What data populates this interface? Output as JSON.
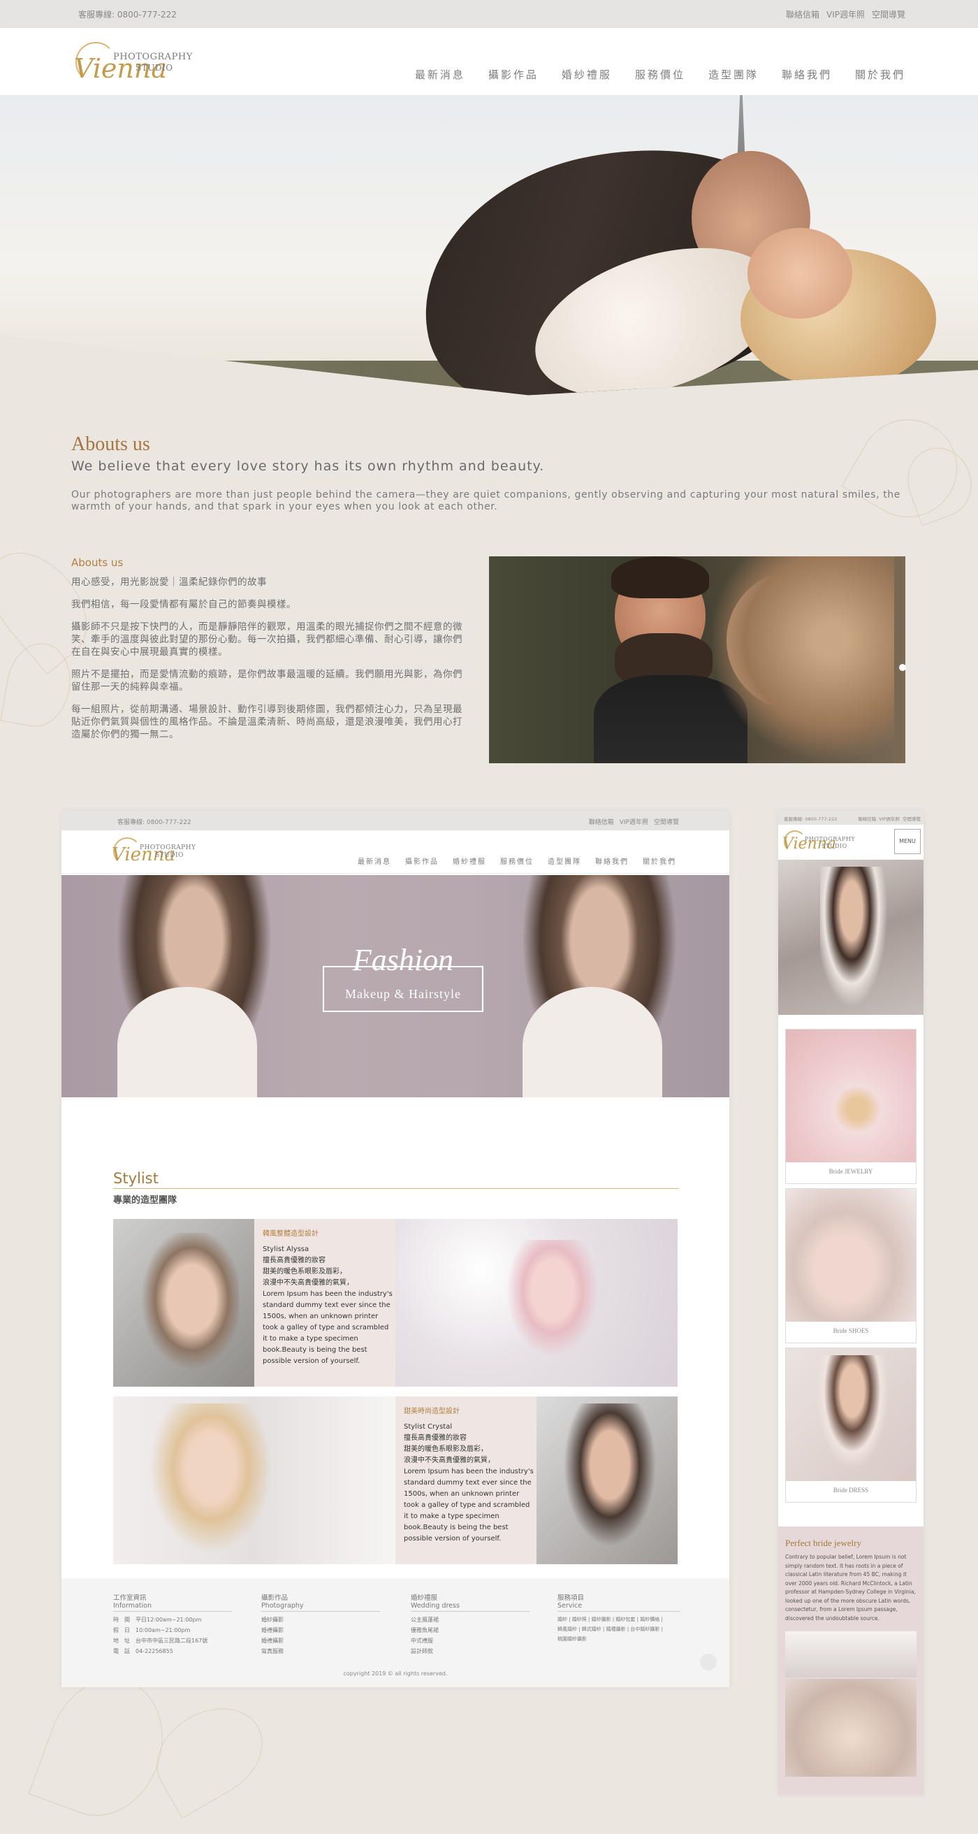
{
  "topbar": {
    "phone": "客服專線: 0800-777-222",
    "links": [
      "聯絡信箱",
      "VIP週年照",
      "空間導覽"
    ]
  },
  "logo": {
    "script": "Vienna",
    "line1": "PHOTOGRAPHY",
    "line2": "STUDIO"
  },
  "nav": [
    "最新消息",
    "攝影作品",
    "婚紗禮服",
    "服務價位",
    "造型團隊",
    "聯絡我們",
    "關於我們"
  ],
  "about": {
    "title": "Abouts us",
    "tagline": "We believe that every love story has its own rhythm and beauty.",
    "intro": "Our photographers are more than just people behind the camera—they are quiet companions, gently observing and capturing your most natural smiles, the warmth of your hands, and that spark in your eyes when you look at each other.",
    "subtitle": "Abouts us",
    "p0": "用心感受，用光影說愛｜溫柔紀錄你們的故事",
    "p1": "我們相信，每一段愛情都有屬於自己的節奏與模樣。",
    "p2": "攝影師不只是按下快門的人，而是靜靜陪伴的觀眾，用溫柔的眼光捕捉你們之間不經意的微笑、牽手的溫度與彼此對望的那份心動。每一次拍攝，我們都細心準備、耐心引導，讓你們在自在與安心中展現最真實的模樣。",
    "p3": "照片不是擺拍，而是愛情流動的痕跡，是你們故事最溫暖的延續。我們願用光與影，為你們留住那一天的純粹與幸福。",
    "p4": "每一組照片，從前期溝通、場景設計、動作引導到後期修圖，我們都傾注心力，只為呈現最貼近你們氣質與個性的風格作品。不論是溫柔清新、時尚高級，還是浪漫唯美，我們用心打造屬於你們的獨一無二。"
  },
  "desktop": {
    "phone": "客服專線: 0800-777-222",
    "links": [
      "聯絡信箱",
      "VIP週年照",
      "空間導覽"
    ],
    "hero_title": "Fashion",
    "hero_sub": "Makeup & Hairstyle",
    "stylist_title": "Stylist",
    "stylist_sub": "專業的造型團隊",
    "card1": {
      "role": "韓風整體造型設計",
      "name": "Stylist Alyssa",
      "lines": [
        "擅長高貴優雅的妝容",
        "甜美的暖色系眼影及唇彩，",
        "浪漫中不失高貴優雅的氣質，"
      ],
      "body": "Lorem Ipsum has been the industry's standard dummy text ever since the 1500s, when an unknown printer took a galley of type and scrambled it to make a type specimen book.Beauty is being the best possible version of yourself."
    },
    "card2": {
      "role": "甜美時尚造型設計",
      "name": "Stylist Crystal",
      "lines": [
        "擅長高貴優雅的妝容",
        "甜美的暖色系眼影及唇彩，",
        "浪漫中不失高貴優雅的氣質，"
      ],
      "body": "Lorem Ipsum has been the industry's standard dummy text ever since the 1500s, when an unknown printer took a galley of type and scrambled it to make a type specimen book.Beauty is being the best possible version of yourself."
    },
    "footer": {
      "col1": {
        "title": "工作室資訊",
        "en": "Information",
        "rows": [
          "時　間　平日12:00am~21:00pm",
          "假　日　10:00am~21:00pm",
          "地　址　台中市中區三民路二段167號",
          "電　話　04-22256855"
        ]
      },
      "col2": {
        "title": "攝影作品",
        "en": "Photography",
        "rows": [
          "婚紗攝影",
          "婚禮攝影",
          "婚禮攝影",
          "寫真服務"
        ]
      },
      "col3": {
        "title": "婚紗禮服",
        "en": "Wedding dress",
        "rows": [
          "公主風蓬裙",
          "優雅魚尾裙",
          "中式禮服",
          "設計師款"
        ]
      },
      "col4": {
        "title": "服務項目",
        "en": "Service",
        "rows": [
          "婚紗 | 婚紗照 | 婚紗攝影 | 婚紗包套 | 婚紗價格 |",
          "韓風婚紗 | 韓式婚紗 | 婚禮攝影 | 台中婚紗攝影 |",
          "桃園婚紗攝影"
        ]
      },
      "copyright": "copyright 2019 © all rights reserved."
    }
  },
  "mobile": {
    "phone": "客服專線: 0800-777-222",
    "links": [
      "聯絡信箱",
      "VIP週年照",
      "空間導覽"
    ],
    "menu": "MENU",
    "cards": [
      "Bride JEWELRY",
      "Bride SHOES",
      "Bride DRESS"
    ],
    "pbj_title": "Perfect bride jewelry",
    "pbj_body": "Contrary to popular belief, Lorem Ipsum is not simply random text. It has roots in a piece of classical Latin literature from 45 BC, making it over 2000 years old. Richard McClintock, a Latin professor at Hampden-Sydney College in Virginia, looked up one of the more obscure Latin words, consectetur, from a Lorem Ipsum passage, discovered the undoubtable source."
  }
}
